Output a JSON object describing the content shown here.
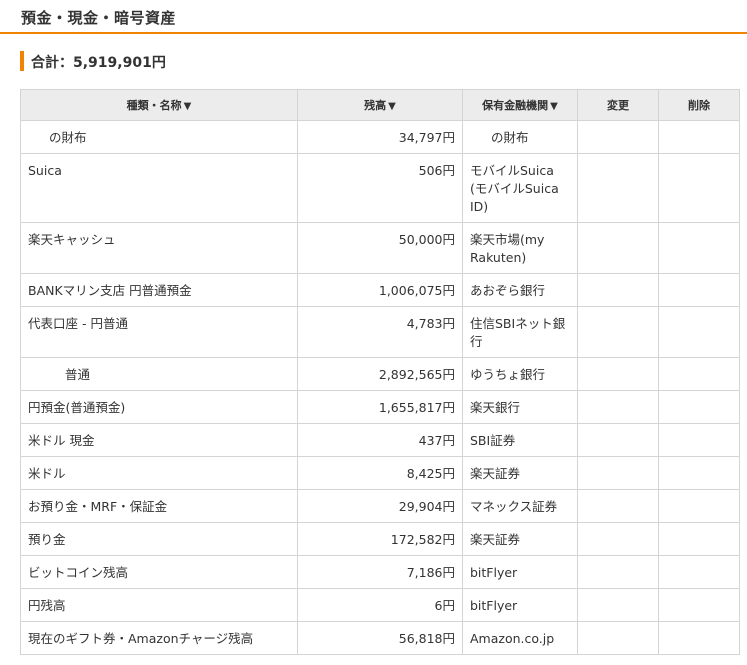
{
  "section": {
    "title": "預金・現金・暗号資産"
  },
  "total": {
    "label": "合計：5,919,901円"
  },
  "table": {
    "headers": {
      "name": "種類・名称",
      "balance": "残高",
      "institution": "保有金融機関",
      "edit": "変更",
      "delete": "削除"
    },
    "sort_icon": "▼",
    "rows": [
      {
        "name": "の財布",
        "balance": "34,797円",
        "institution": "の財布"
      },
      {
        "name": "Suica",
        "balance": "506円",
        "institution": "モバイルSuica (モバイルSuica ID)"
      },
      {
        "name": "楽天キャッシュ",
        "balance": "50,000円",
        "institution": "楽天市場(my Rakuten)"
      },
      {
        "name": "BANKマリン支店 円普通預金",
        "balance": "1,006,075円",
        "institution": "あおぞら銀行"
      },
      {
        "name": "代表口座 - 円普通",
        "balance": "4,783円",
        "institution": "住信SBIネット銀行"
      },
      {
        "name": "普通",
        "balance": "2,892,565円",
        "institution": "ゆうちょ銀行"
      },
      {
        "name": "円預金(普通預金)",
        "balance": "1,655,817円",
        "institution": "楽天銀行"
      },
      {
        "name": "米ドル 現金",
        "balance": "437円",
        "institution": "SBI証券"
      },
      {
        "name": "米ドル",
        "balance": "8,425円",
        "institution": "楽天証券"
      },
      {
        "name": "お預り金・MRF・保証金",
        "balance": "29,904円",
        "institution": "マネックス証券"
      },
      {
        "name": "預り金",
        "balance": "172,582円",
        "institution": "楽天証券"
      },
      {
        "name": "ビットコイン残高",
        "balance": "7,186円",
        "institution": "bitFlyer"
      },
      {
        "name": "円残高",
        "balance": "6円",
        "institution": "bitFlyer"
      },
      {
        "name": "現在のギフト券・Amazonチャージ残高",
        "balance": "56,818円",
        "institution": "Amazon.co.jp"
      }
    ]
  },
  "colors": {
    "accent": "#f08300",
    "header_bg": "#ececec",
    "border": "#d4d4d4"
  }
}
